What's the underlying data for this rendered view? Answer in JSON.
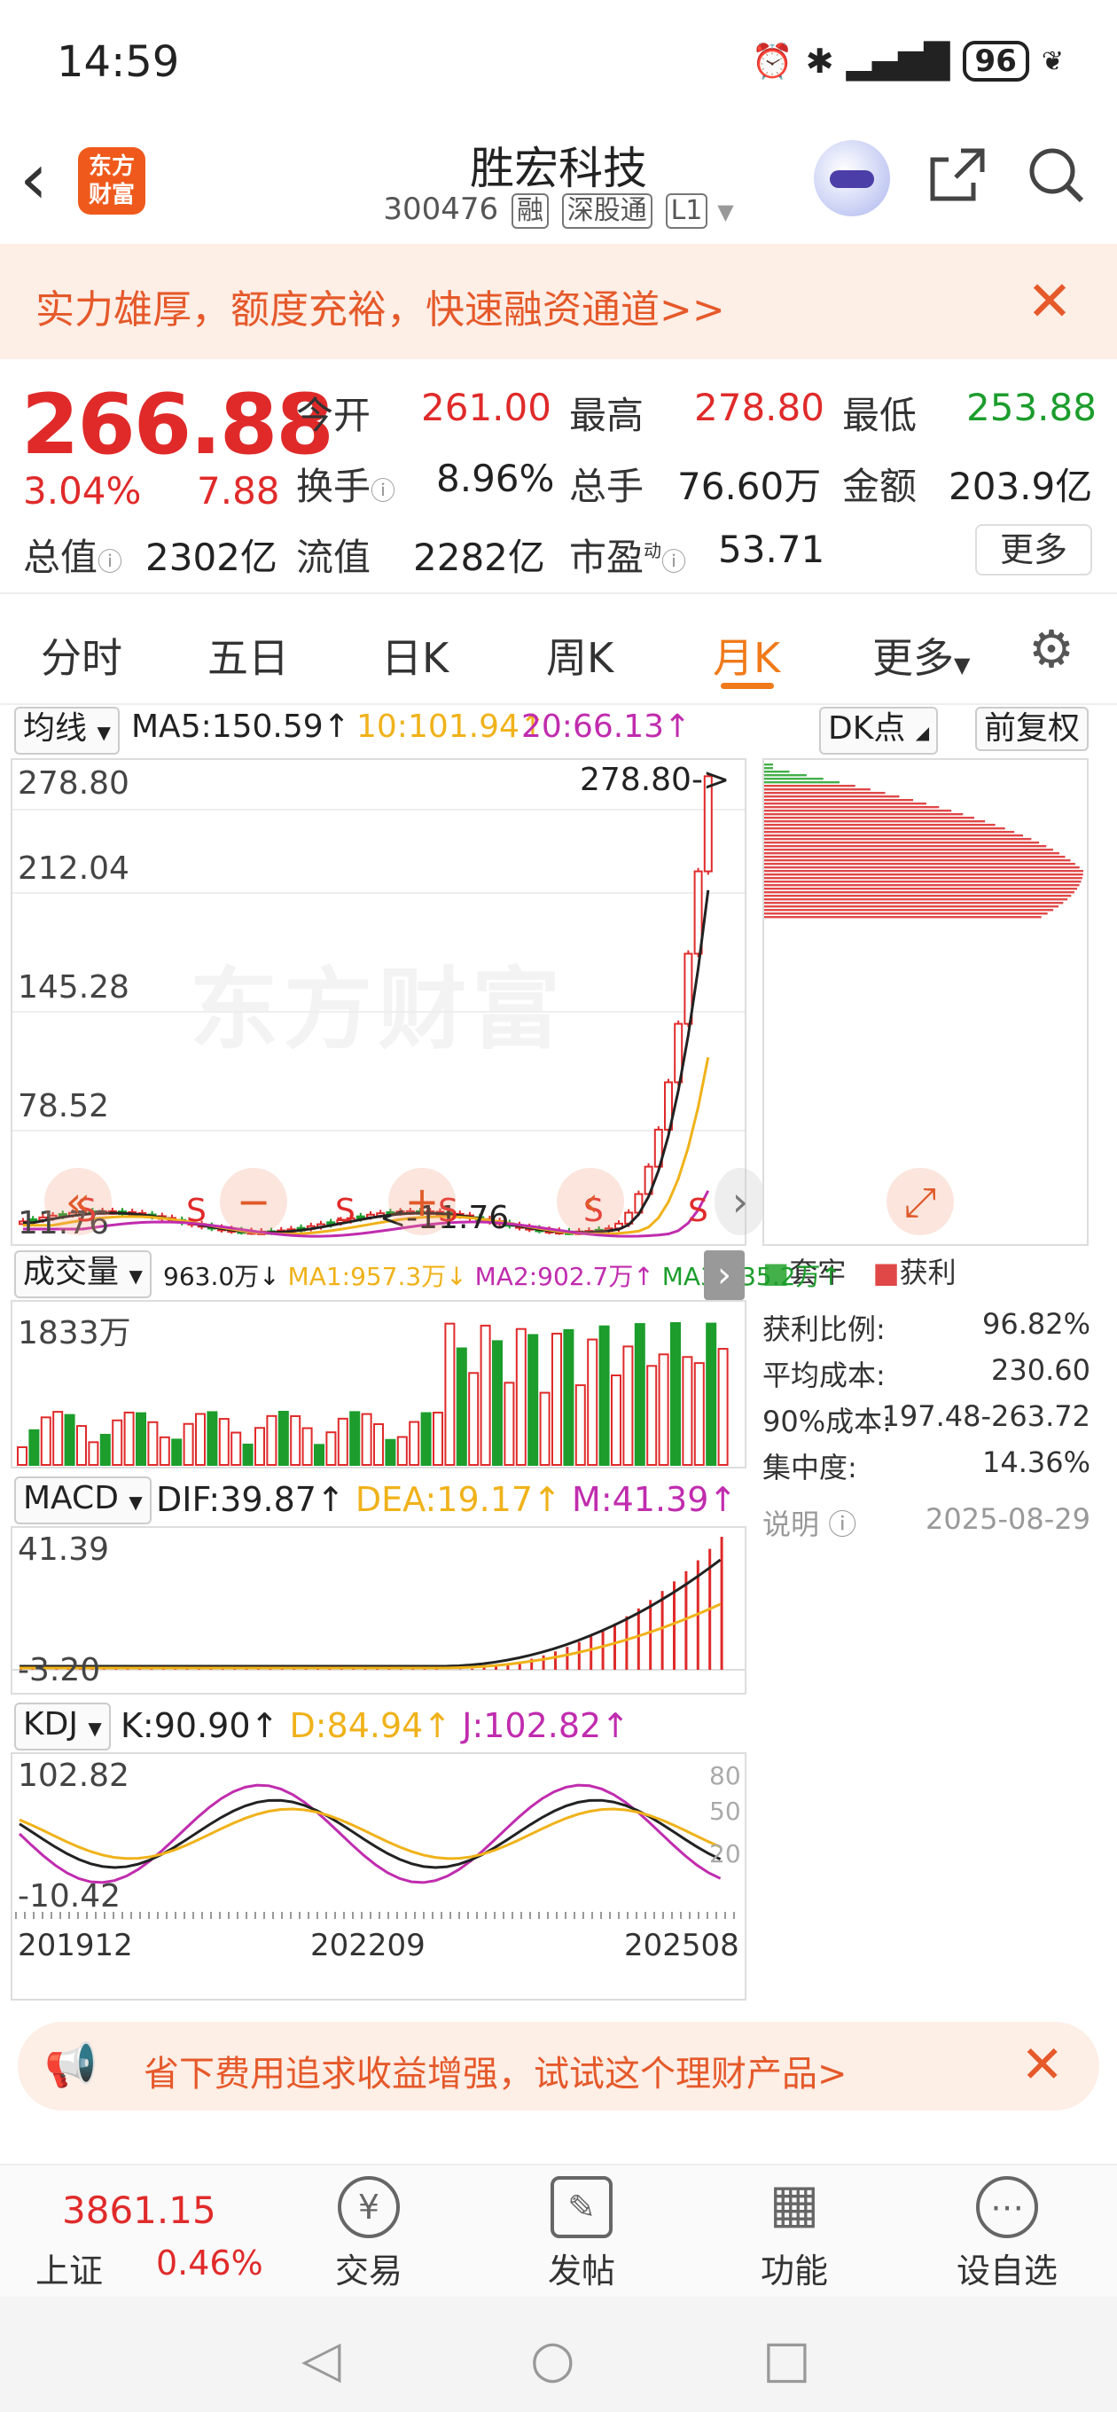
{
  "status": {
    "time": "14:59",
    "battery": "96"
  },
  "nav": {
    "logo_text": "东方财富",
    "title": "胜宏科技",
    "code": "300476",
    "tags": [
      "融",
      "深股通",
      "L1"
    ]
  },
  "banner": {
    "text": "实力雄厚，额度充裕，快速融资通道>>"
  },
  "quote": {
    "price": "266.88",
    "change_pct": "3.04%",
    "change": "7.88",
    "open_label": "今开",
    "open": "261.00",
    "high_label": "最高",
    "high": "278.80",
    "low_label": "最低",
    "low": "253.88",
    "turnover_label": "换手",
    "turnover": "8.96%",
    "volume_label": "总手",
    "volume": "76.60万",
    "amount_label": "金额",
    "amount": "203.9亿",
    "mktcap_label": "总值",
    "mktcap": "2302亿",
    "float_label": "流值",
    "float": "2282亿",
    "pe_label": "市盈",
    "pe_sup": "动",
    "pe": "53.71",
    "more": "更多"
  },
  "tabs": [
    {
      "label": "分时"
    },
    {
      "label": "五日"
    },
    {
      "label": "日K"
    },
    {
      "label": "周K"
    },
    {
      "label": "月K"
    },
    {
      "label": "更多"
    }
  ],
  "ma": {
    "selector": "均线",
    "ma5": "MA5:150.59↑",
    "ma10": "10:101.94↑",
    "ma20": "20:66.13↑",
    "dk": "DK点",
    "adj": "前复权"
  },
  "chart": {
    "y_labels": [
      "278.80",
      "212.04",
      "145.28",
      "78.52",
      "11.76"
    ],
    "max_annot": "278.80->",
    "min_annot": "<-11.76",
    "watermark": "东方财富",
    "s_marks": [
      "S",
      "S",
      "S",
      "S",
      "S",
      "S"
    ],
    "x_labels": [
      "201912",
      "202209",
      "202508"
    ]
  },
  "chips": {
    "legend_trap": "套牢",
    "legend_profit": "获利",
    "rows": [
      {
        "label": "获利比例:",
        "value": "96.82%"
      },
      {
        "label": "平均成本:",
        "value": "230.60"
      },
      {
        "label": "90%成本:",
        "value": "197.48-263.72"
      },
      {
        "label": "集中度:",
        "value": "14.36%"
      }
    ],
    "note": "说明",
    "date": "2025-08-29"
  },
  "volume": {
    "selector": "成交量",
    "v": "963.0万↓",
    "ma1": "MA1:957.3万↓",
    "ma2": "MA2:902.7万↑",
    "ma3": "MA3:835.2万↑",
    "ymax": "1833万"
  },
  "macd": {
    "selector": "MACD",
    "dif": "DIF:39.87↑",
    "dea": "DEA:19.17↑",
    "m": "M:41.39↑",
    "ymax": "41.39",
    "ymin": "-3.20"
  },
  "kdj": {
    "selector": "KDJ",
    "k": "K:90.90↑",
    "d": "D:84.94↑",
    "j": "J:102.82↑",
    "ymax": "102.82",
    "ymin": "-10.42",
    "levels": [
      "80",
      "50",
      "20"
    ]
  },
  "ad": {
    "text": "省下费用追求收益增强，试试这个理财产品>"
  },
  "bottom": {
    "index_value": "3861.15",
    "index_name": "上证",
    "index_pct": "0.46%",
    "items": [
      {
        "label": "交易",
        "icon": "¥"
      },
      {
        "label": "发帖",
        "icon": "✎"
      },
      {
        "label": "功能",
        "icon": "▦"
      },
      {
        "label": "设自选",
        "icon": "⋯"
      }
    ]
  },
  "colors": {
    "up": "#e02a2a",
    "down": "#1c9d2c",
    "accent": "#f07a1a",
    "ma10": "#f0b21a",
    "ma20": "#c02cae"
  }
}
